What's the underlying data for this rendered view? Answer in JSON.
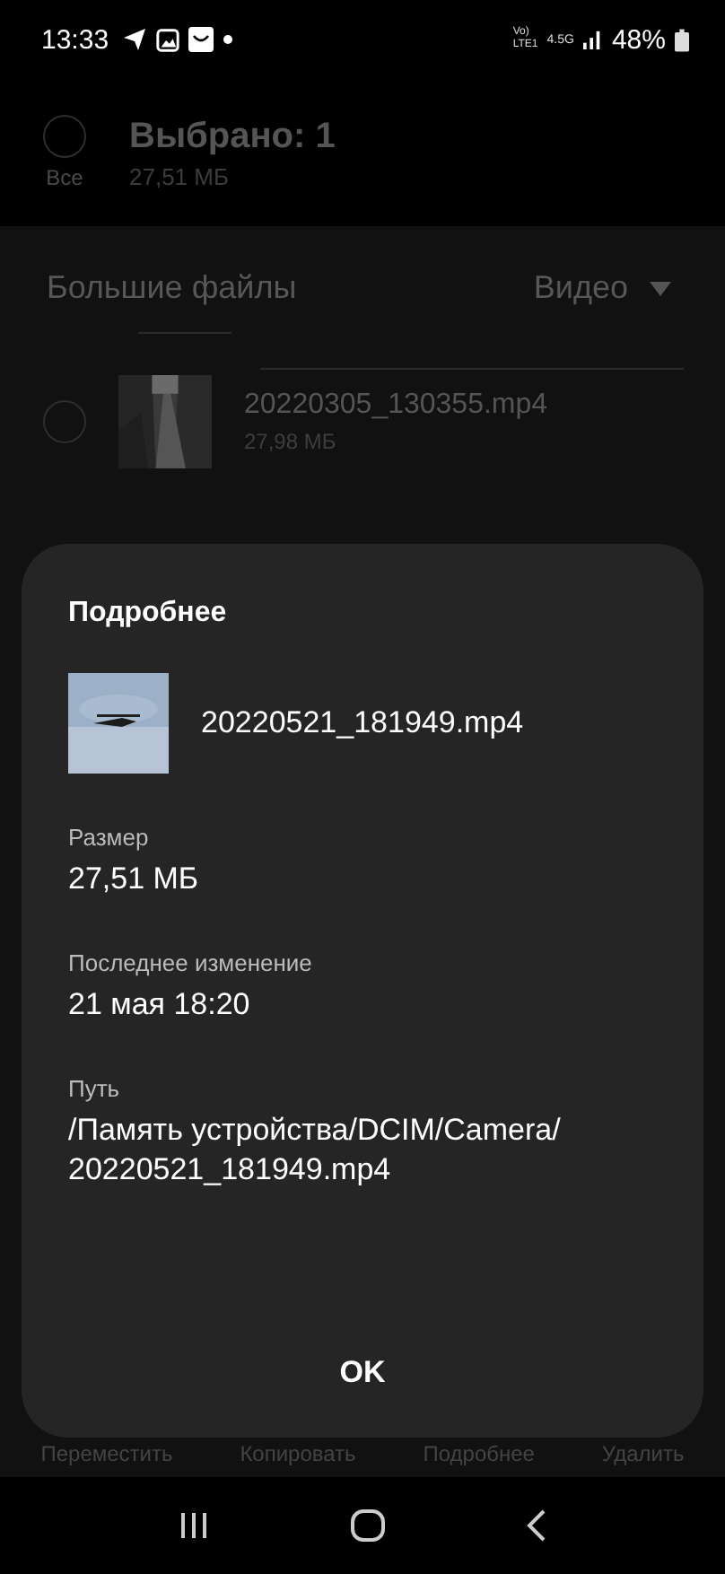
{
  "status_bar": {
    "time": "13:33",
    "volte": [
      "Vo)",
      "LTE1"
    ],
    "network": "4.5G",
    "battery": "48%"
  },
  "header": {
    "all_label": "Все",
    "all_selected": false,
    "title": "Выбрано: 1",
    "size": "27,51 МБ"
  },
  "section": {
    "title": "Большие файлы",
    "filter": "Видео"
  },
  "files": [
    {
      "name": "20220305_130355.mp4",
      "size": "27,98 МБ",
      "selected": false
    }
  ],
  "dialog": {
    "title": "Подробнее",
    "file_name": "20220521_181949.mp4",
    "fields": [
      {
        "label": "Размер",
        "value": "27,51 МБ"
      },
      {
        "label": "Последнее изменение",
        "value": "21 мая 18:20"
      },
      {
        "label": "Путь",
        "value": "/Память устройства/DCIM/Camera/ 20220521_181949.mp4"
      }
    ],
    "button": "OK"
  },
  "actions": [
    "Переместить",
    "Копировать",
    "Подробнее",
    "Удалить"
  ]
}
